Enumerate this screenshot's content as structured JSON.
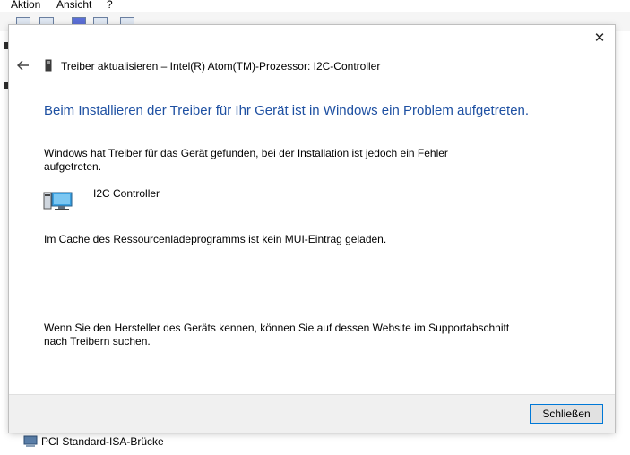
{
  "background_window": {
    "menu": {
      "action": "Aktion",
      "view": "Ansicht",
      "help": "?"
    },
    "device_list_item": "PCI Standard-ISA-Brücke"
  },
  "dialog": {
    "header_title": "Treiber aktualisieren – Intel(R) Atom(TM)-Prozessor: I2C-Controller",
    "heading": "Beim Installieren der Treiber für Ihr Gerät ist in Windows ein Problem aufgetreten.",
    "paragraph1": "Windows hat Treiber für das Gerät gefunden, bei der Installation ist jedoch ein Fehler aufgetreten.",
    "device_name": "I2C Controller",
    "error_message": "Im Cache des Ressourcenladeprogramms ist kein MUI-Eintrag geladen.",
    "paragraph2": "Wenn Sie den Hersteller des Geräts kennen, können Sie auf dessen Website im Supportabschnitt nach Treibern suchen.",
    "close_button_label": "Schließen",
    "close_glyph": "✕",
    "accent_color": "#1e50a2",
    "button_border_color": "#0078d7"
  },
  "icons": {
    "back": "back-arrow-icon",
    "header": "device-icon",
    "device": "computer-monitor-icon",
    "close": "close-icon"
  }
}
